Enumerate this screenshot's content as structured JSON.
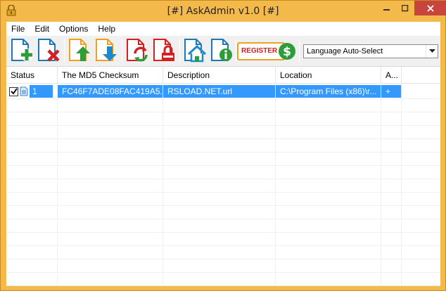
{
  "window": {
    "title": "[#] AskAdmin v1.0 [#]",
    "accent": "#f3b94a",
    "close_color": "#c7453c"
  },
  "menu": [
    "File",
    "Edit",
    "Options",
    "Help"
  ],
  "toolbar": {
    "buttons": [
      {
        "name": "add",
        "icon": "add-file-icon",
        "color": "#2e9c3a"
      },
      {
        "name": "remove",
        "icon": "remove-file-icon",
        "color": "#d32020"
      },
      {
        "name": "move-up",
        "icon": "arrow-up-icon",
        "color": "#2e9c3a"
      },
      {
        "name": "move-down",
        "icon": "arrow-down-icon",
        "color": "#1e88c8"
      },
      {
        "name": "refresh",
        "icon": "refresh-icon",
        "color": "#d32020"
      },
      {
        "name": "lock",
        "icon": "lock-icon",
        "color": "#d32020"
      },
      {
        "name": "home",
        "icon": "home-icon",
        "color": "#1e88c8"
      },
      {
        "name": "info",
        "icon": "info-icon",
        "color": "#2e9c3a"
      }
    ],
    "register_label": "REGISTER",
    "language": "Language Auto-Select"
  },
  "table": {
    "columns": [
      "Status",
      "The MD5 Checksum",
      "Description",
      "Location",
      "A..."
    ],
    "rows": [
      {
        "checked": true,
        "status": "1",
        "md5": "FC46F7ADE08FAC419A5...",
        "description": "RSLOAD.NET.url",
        "location": "C:\\Program Files (x86)\\r...",
        "a": "+"
      }
    ],
    "selection_color": "#3399ff"
  }
}
